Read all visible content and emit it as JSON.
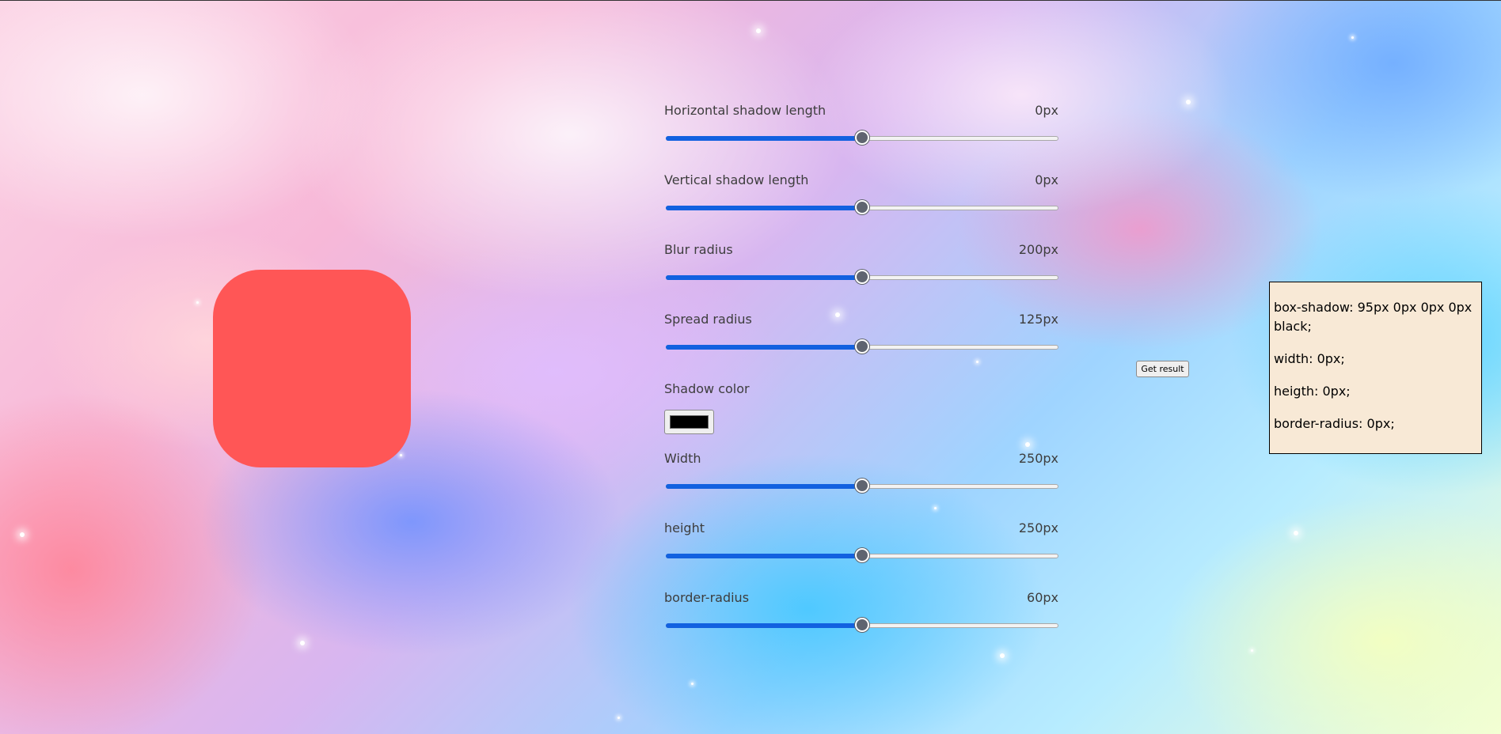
{
  "colors": {
    "preview_box": "#ff5656",
    "slider_accent": "#1261e0",
    "result_panel": "#f8e9d6",
    "shadow_color": "#000000"
  },
  "controls": {
    "horizontal": {
      "label": "Horizontal shadow length",
      "value": "0px",
      "slider_fraction": 0.5
    },
    "vertical": {
      "label": "Vertical shadow length",
      "value": "0px",
      "slider_fraction": 0.5
    },
    "blur": {
      "label": "Blur radius",
      "value": "200px",
      "slider_fraction": 0.5
    },
    "spread": {
      "label": "Spread radius",
      "value": "125px",
      "slider_fraction": 0.5
    },
    "shadow_color": {
      "label": "Shadow color",
      "value": "#000000"
    },
    "width": {
      "label": "Width",
      "value": "250px",
      "slider_fraction": 0.5
    },
    "height": {
      "label": "height",
      "value": "250px",
      "slider_fraction": 0.5
    },
    "border_radius": {
      "label": "border-radius",
      "value": "60px",
      "slider_fraction": 0.5
    }
  },
  "get_result_button": {
    "label": "Get result"
  },
  "result": {
    "box_shadow": "box-shadow: 95px 0px 0px 0px black;",
    "width": "width: 0px;",
    "height": "heigth: 0px;",
    "border_radius": "border-radius: 0px;"
  }
}
